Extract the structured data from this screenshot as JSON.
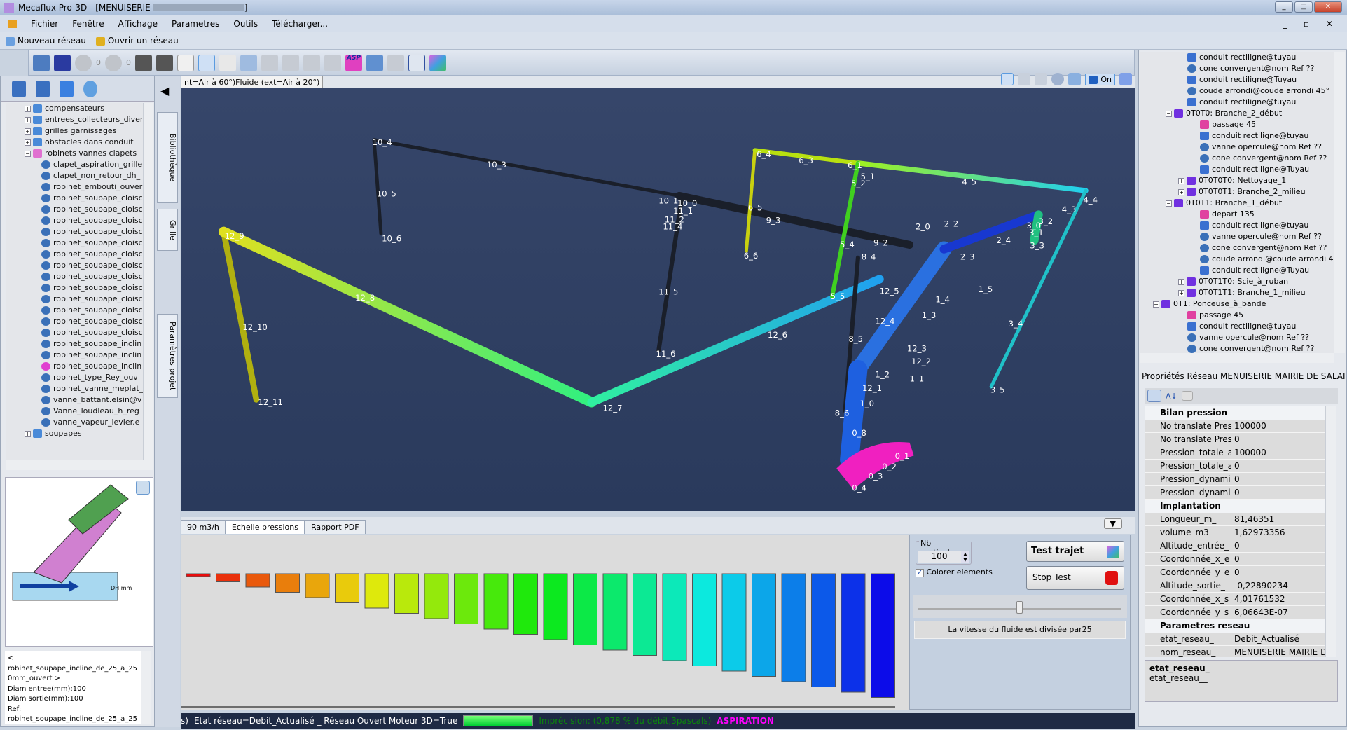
{
  "window": {
    "title": "Mecaflux Pro-3D - [MENUISERIE",
    "title_end": "]",
    "min": "_",
    "max": "□",
    "close": "✕"
  },
  "menu": [
    "Fichier",
    "Fenêtre",
    "Affichage",
    "Parametres",
    "Outils",
    "Télécharger..."
  ],
  "quickbar": {
    "new": "Nouveau réseau",
    "open": "Ouvrir un réseau"
  },
  "toolbar": {
    "undo_count": "0",
    "redo_count": "0",
    "asp_label": "ASP"
  },
  "left_tree": {
    "folders_top": [
      "compensateurs",
      "entrees_collecteurs_divers",
      "grilles garnissages",
      "obstacles dans conduit"
    ],
    "open_folder": "robinets vannes clapets",
    "items": [
      "clapet_aspiration_grille",
      "clapet_non_retour_dh_",
      "robinet_embouti_ouver",
      "robinet_soupape_cloisc",
      "robinet_soupape_cloisc",
      "robinet_soupape_cloisc",
      "robinet_soupape_cloisc",
      "robinet_soupape_cloisc",
      "robinet_soupape_cloisc",
      "robinet_soupape_cloisc",
      "robinet_soupape_cloisc",
      "robinet_soupape_cloisc",
      "robinet_soupape_cloisc",
      "robinet_soupape_cloisc",
      "robinet_soupape_cloisc",
      "robinet_soupape_cloisc",
      "robinet_soupape_inclin",
      "robinet_soupape_inclin",
      "robinet_soupape_inclin",
      "robinet_type_Rey_ouv",
      "robinet_vanne_meplat_",
      "vanne_battant.elsin@v",
      "Vanne_loudleau_h_reg",
      "vanne_vapeur_levier.e"
    ],
    "selected_index": 18,
    "folder_bottom": "soupapes"
  },
  "preview": {
    "dim_label": "DH mm"
  },
  "info_text": [
    "<",
    "robinet_soupape_incline_de_25_a_25",
    "0mm_ouvert >",
    "Diam entree(mm):100",
    "Diam sortie(mm):100",
    "Ref:",
    "robinet_soupape_incline_de_25_a_25"
  ],
  "vtabs": [
    "Bibliothèque",
    "Grille",
    "Paramètres projet"
  ],
  "view": {
    "tab_label": "nt=Air à 60°)Fluide (ext=Air à 20°)",
    "on_label": "On",
    "labels": [
      "10_4",
      "10_3",
      "10_5",
      "10_6",
      "12_9",
      "12_8",
      "12_10",
      "12_11",
      "12_7",
      "12_6",
      "11_6",
      "11_5",
      "10_1",
      "10_0",
      "11_1",
      "11_2",
      "11_4",
      "9_3",
      "6_5",
      "6_6",
      "6_4",
      "6_3",
      "5_4",
      "5_5",
      "8_5",
      "8_6",
      "0_8",
      "0_4",
      "0_3",
      "0_2",
      "0_1",
      "12_5",
      "12_4",
      "12_3",
      "12_2",
      "1_2",
      "1_1",
      "12_1",
      "1_0",
      "1_3",
      "1_4",
      "1_5",
      "2_0",
      "2_2",
      "2_4",
      "2_3",
      "4_5",
      "4_4",
      "4_3",
      "3_1",
      "3_3",
      "3_4",
      "3_5",
      "5_1",
      "5_2",
      "6_1",
      "8_4",
      "9_2",
      "3_0",
      "3_2"
    ]
  },
  "bottom_tabs": [
    "90 m3/h",
    "Echelle pressions",
    "Rapport PDF"
  ],
  "active_bottom_tab": 1,
  "particles": {
    "label": "Nb particules",
    "value": "100",
    "colorer": "Colorer elements",
    "colorer_checked": true,
    "test": "Test trajet",
    "stop": "Stop Test",
    "speed_text": "La vitesse du fluide est divisée par25",
    "slider_level": 0.5
  },
  "status": {
    "left": "s)",
    "etat": "Etat réseau=Debit_Actualisé _ Réseau Ouvert Moteur 3D=True",
    "progress": 1.0,
    "precision": "Imprécision: (0,878 % du débit,3pascals)",
    "mode": "ASPIRATION",
    "precision_color": "#0a8a0a",
    "mode_color": "#ff00ff"
  },
  "right_tree": [
    {
      "lvl": 3,
      "t": "conduit rectiligne@tuyau",
      "i": "pipe"
    },
    {
      "lvl": 3,
      "t": "cone convergent@nom Ref ??",
      "i": "ball"
    },
    {
      "lvl": 3,
      "t": "conduit rectiligne@Tuyau",
      "i": "pipe"
    },
    {
      "lvl": 3,
      "t": "coude arrondi@coude arrondi 45°",
      "i": "ball"
    },
    {
      "lvl": 3,
      "t": "conduit rectiligne@tuyau",
      "i": "pipe"
    },
    {
      "lvl": 2,
      "t": "0T0T0: Branche_2_début",
      "i": "grid",
      "exp": "−"
    },
    {
      "lvl": 4,
      "t": "passage 45",
      "i": "arrow"
    },
    {
      "lvl": 4,
      "t": "conduit rectiligne@tuyau",
      "i": "pipe"
    },
    {
      "lvl": 4,
      "t": "vanne opercule@nom Ref ??",
      "i": "ball"
    },
    {
      "lvl": 4,
      "t": "cone convergent@nom Ref ??",
      "i": "ball"
    },
    {
      "lvl": 4,
      "t": "conduit rectiligne@Tuyau",
      "i": "pipe"
    },
    {
      "lvl": 3,
      "t": "0T0T0T0: Nettoyage_1",
      "i": "grid",
      "exp": "+"
    },
    {
      "lvl": 3,
      "t": "0T0T0T1: Branche_2_milieu",
      "i": "grid",
      "exp": "+"
    },
    {
      "lvl": 2,
      "t": "0T0T1: Branche_1_début",
      "i": "grid",
      "exp": "−"
    },
    {
      "lvl": 4,
      "t": "depart 135",
      "i": "arrow"
    },
    {
      "lvl": 4,
      "t": "conduit rectiligne@tuyau",
      "i": "pipe"
    },
    {
      "lvl": 4,
      "t": "vanne opercule@nom Ref ??",
      "i": "ball"
    },
    {
      "lvl": 4,
      "t": "cone convergent@nom Ref ??",
      "i": "ball"
    },
    {
      "lvl": 4,
      "t": "coude arrondi@coude arrondi 4",
      "i": "ball"
    },
    {
      "lvl": 4,
      "t": "conduit rectiligne@Tuyau",
      "i": "pipe"
    },
    {
      "lvl": 3,
      "t": "0T0T1T0: Scie_à_ruban",
      "i": "grid",
      "exp": "+"
    },
    {
      "lvl": 3,
      "t": "0T0T1T1: Branche_1_milieu",
      "i": "grid",
      "exp": "+"
    },
    {
      "lvl": 1,
      "t": "0T1: Ponceuse_à_bande",
      "i": "grid",
      "exp": "−"
    },
    {
      "lvl": 3,
      "t": "passage 45",
      "i": "arrow"
    },
    {
      "lvl": 3,
      "t": "conduit rectiligne@tuyau",
      "i": "pipe"
    },
    {
      "lvl": 3,
      "t": "vanne opercule@nom Ref ??",
      "i": "ball"
    },
    {
      "lvl": 3,
      "t": "cone convergent@nom Ref ??",
      "i": "ball"
    }
  ],
  "properties": {
    "title": "Propriétés Réseau MENUISERIE MAIRIE DE SALAI",
    "categories": [
      {
        "name": "Bilan pression",
        "rows": [
          [
            "No translate Pres",
            "100000"
          ],
          [
            "No translate Pres",
            "0"
          ],
          [
            "Pression_totale_a",
            "100000"
          ],
          [
            "Pression_totale_a",
            "0"
          ],
          [
            "Pression_dynami",
            "0"
          ],
          [
            "Pression_dynami",
            "0"
          ]
        ]
      },
      {
        "name": "Implantation",
        "rows": [
          [
            "Longueur_m_",
            "81,46351"
          ],
          [
            "volume_m3_",
            "1,62973356"
          ],
          [
            "Altitude_entrée_",
            "0"
          ],
          [
            "Coordonnée_x_e",
            "0"
          ],
          [
            "Coordonnée_y_e",
            "0"
          ],
          [
            "Altitude_sortie_",
            "-0,22890234"
          ],
          [
            "Coordonnée_x_s",
            "4,01761532"
          ],
          [
            "Coordonnée_y_s",
            "6,06643E-07"
          ]
        ]
      },
      {
        "name": "Parametres reseau",
        "rows": [
          [
            "etat_reseau_",
            "Debit_Actualisé"
          ],
          [
            "nom_reseau_",
            "MENUISERIE MAIRIE DE"
          ]
        ]
      }
    ],
    "desc_title": "etat_reseau_",
    "desc_text": "etat_reseau__"
  }
}
